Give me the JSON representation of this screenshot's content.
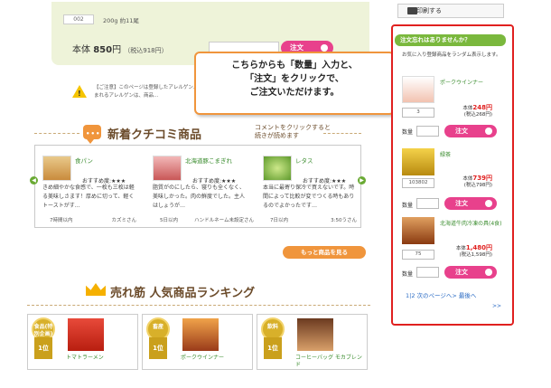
{
  "product_top": {
    "code": "002",
    "spec": "200g 約11尾",
    "price_label": "本体",
    "price_value": "850",
    "price_unit": "円",
    "tax_price": "（税込918円）",
    "order_label": "注文"
  },
  "notice": {
    "text": "【ご注意】このページは登録したアレルゲン… 商品に含まれるアレルゲンは、商品…"
  },
  "callout": {
    "line1": "こちらからも「数量」入力と、",
    "line2": "「注文」をクリックで、",
    "line3": "ご注文いただけます。"
  },
  "reviews": {
    "title": "新着クチコミ商品",
    "subtitle_line1": "コメントをクリックすると",
    "subtitle_line2": "続きが読めます",
    "items": [
      {
        "name": "食パン",
        "rating": "おすすめ度:★★★",
        "text": "きめ細やかな食感で、一枚も三枚は軽る美味しさます！厚めに切って、軽くトーストがす…",
        "date": "7時間以内",
        "user": "カズミさん"
      },
      {
        "name": "北海道豚こまぎれ",
        "rating": "おすすめ度:★★★",
        "text": "脂質がのにしたら、寝りも全くなく、美味しかった。肉の鮮度でした。主人はしょうが…",
        "date": "5日以内",
        "user": "ハンドルネーム未設定さん"
      },
      {
        "name": "レタス",
        "rating": "おすすめ度:★★★",
        "text": "本当に最寄り保冷で買えないです。時間によって比較が変でつくる時もありるのでよかったです…",
        "date": "7日以内",
        "user": "3:50うさん"
      }
    ],
    "more_label": "もっと商品を見る"
  },
  "ranking": {
    "title": "売れ筋 人気商品ランキング",
    "items": [
      {
        "category": "食品(特別企画)",
        "rank": "1位",
        "name": "トマトラーメン"
      },
      {
        "category": "畜産",
        "rank": "1位",
        "name": "ポークウインナー"
      },
      {
        "category": "飲料",
        "rank": "1位",
        "name": "コーヒーバッグ モカブレンド"
      }
    ]
  },
  "sidebar": {
    "print_label": "印刷する",
    "header": "注文忘れはありませんか？",
    "description": "お気に入り登録商品をランダム表示します。",
    "items": [
      {
        "name": "ポークウインナー",
        "code": "3",
        "price_label": "本体",
        "price": "248円",
        "tax": "(税込268円)",
        "qty_label": "数量",
        "order": "注文"
      },
      {
        "name": "緑茶",
        "code": "103802",
        "price_label": "本体",
        "price": "739円",
        "tax": "(税込798円)",
        "qty_label": "数量",
        "order": "注文"
      },
      {
        "name": "北海道牛肉冷凍の具(4食)",
        "code": "75",
        "price_label": "本体",
        "price": "1,480円",
        "tax": "(税込1,598円)",
        "qty_label": "数量",
        "order": "注文"
      }
    ],
    "pager": "1|2  次のページへ>  最後へ",
    "pager_more": ">>"
  },
  "colors": {
    "accent_green": "#7ab83d",
    "order_pink": "#e8418c",
    "highlight_red": "#e0201f",
    "orange": "#f0953c"
  }
}
